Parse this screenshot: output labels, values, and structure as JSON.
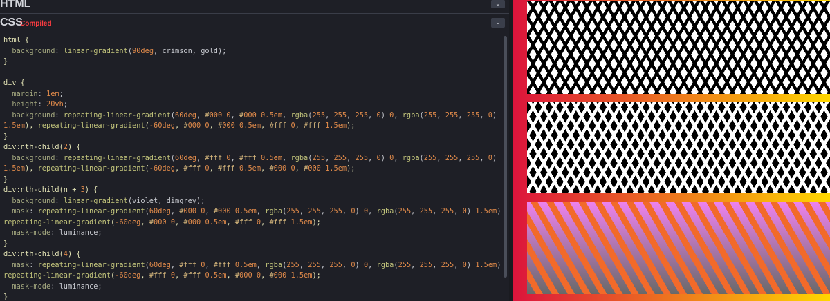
{
  "panels": {
    "html_title": "HTML",
    "css_title": "CSS",
    "css_badge": "Compiled",
    "collapse_icon": "chevron-down-icon"
  },
  "code_lines": [
    "html {",
    "  background: linear-gradient(90deg, crimson, gold);",
    "}",
    "",
    "div {",
    "  margin: 1em;",
    "  height: 20vh;",
    "  background: repeating-linear-gradient(60deg, #000 0, #000 0.5em, rgba(255, 255, 255, 0) 0, rgba(255, 255, 255, 0)",
    "1.5em), repeating-linear-gradient(-60deg, #000 0, #000 0.5em, #fff 0, #fff 1.5em);",
    "}",
    "div:nth-child(2) {",
    "  background: repeating-linear-gradient(60deg, #fff 0, #fff 0.5em, rgba(255, 255, 255, 0) 0, rgba(255, 255, 255, 0)",
    "1.5em), repeating-linear-gradient(-60deg, #fff 0, #fff 0.5em, #000 0, #000 1.5em);",
    "}",
    "div:nth-child(n + 3) {",
    "  background: linear-gradient(violet, dimgrey);",
    "  mask: repeating-linear-gradient(60deg, #000 0, #000 0.5em, rgba(255, 255, 255, 0) 0, rgba(255, 255, 255, 0) 1.5em),",
    "repeating-linear-gradient(-60deg, #000 0, #000 0.5em, #fff 0, #fff 1.5em);",
    "  mask-mode: luminance;",
    "}",
    "div:nth-child(4) {",
    "  mask: repeating-linear-gradient(60deg, #fff 0, #fff 0.5em, rgba(255, 255, 255, 0) 0, rgba(255, 255, 255, 0) 1.5em),",
    "repeating-linear-gradient(-60deg, #fff 0, #fff 0.5em, #000 0, #000 1.5em);",
    "  mask-mode: luminance;",
    "}"
  ],
  "colors": {
    "editor_bg": "#1e1f26",
    "badge": "#ff3c41",
    "preview_from": "crimson",
    "preview_to": "gold"
  }
}
